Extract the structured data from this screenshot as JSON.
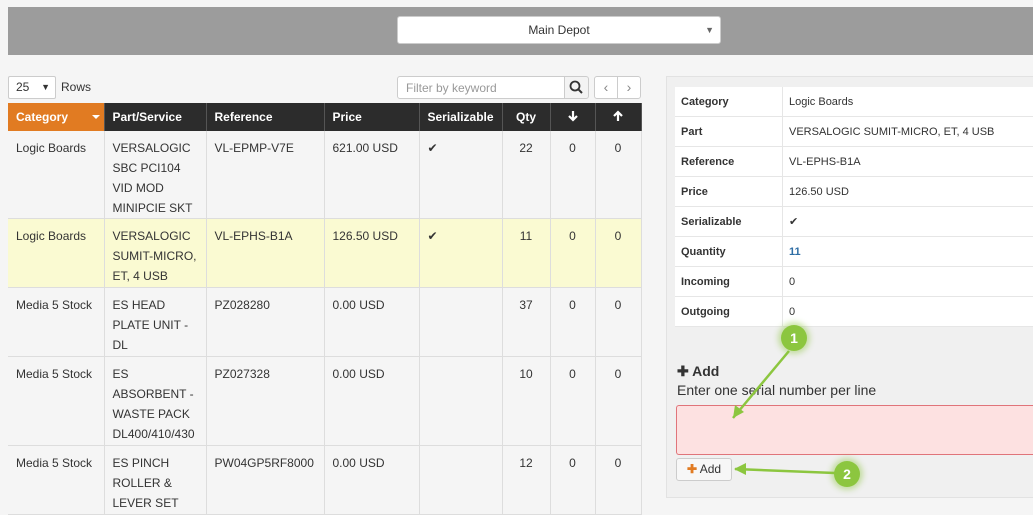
{
  "header": {
    "depot": "Main Depot"
  },
  "toolbar": {
    "rows_value": "25",
    "rows_label": "Rows",
    "filter_placeholder": "Filter by keyword"
  },
  "table": {
    "headers": [
      "Category",
      "Part/Service",
      "Reference",
      "Price",
      "Serializable",
      "Qty"
    ],
    "rows": [
      {
        "category": "Logic Boards",
        "part": "VERSALOGIC SBC PCI104 VID MOD MINIPCIE SKT",
        "reference": "VL-EPMP-V7E",
        "price": "621.00 USD",
        "serializable": "✔",
        "qty": "22",
        "incoming": "0",
        "outgoing": "0"
      },
      {
        "category": "Logic Boards",
        "part": "VERSALOGIC SUMIT-MICRO, ET, 4 USB",
        "reference": "VL-EPHS-B1A",
        "price": "126.50 USD",
        "serializable": "✔",
        "qty": "11",
        "incoming": "0",
        "outgoing": "0"
      },
      {
        "category": "Media 5 Stock",
        "part": "ES HEAD PLATE UNIT - DL",
        "reference": "PZ028280",
        "price": "0.00 USD",
        "serializable": "",
        "qty": "37",
        "incoming": "0",
        "outgoing": "0"
      },
      {
        "category": "Media 5 Stock",
        "part": "ES ABSORBENT - WASTE PACK DL400/410/430",
        "reference": "PZ027328",
        "price": "0.00 USD",
        "serializable": "",
        "qty": "10",
        "incoming": "0",
        "outgoing": "0"
      },
      {
        "category": "Media 5 Stock",
        "part": "ES PINCH ROLLER & LEVER SET",
        "reference": "PW04GP5RF8000",
        "price": "0.00 USD",
        "serializable": "",
        "qty": "12",
        "incoming": "0",
        "outgoing": "0"
      }
    ]
  },
  "details": {
    "rows": [
      {
        "label": "Category",
        "value": "Logic Boards"
      },
      {
        "label": "Part",
        "value": "VERSALOGIC SUMIT-MICRO, ET, 4 USB"
      },
      {
        "label": "Reference",
        "value": "VL-EPHS-B1A"
      },
      {
        "label": "Price",
        "value": "126.50 USD"
      },
      {
        "label": "Serializable",
        "value": "✔"
      },
      {
        "label": "Quantity",
        "value": "11"
      },
      {
        "label": "Incoming",
        "value": "0"
      },
      {
        "label": "Outgoing",
        "value": "0"
      }
    ],
    "add_title": "Add",
    "add_help": "Enter one serial number per line",
    "add_button": "Add"
  },
  "callouts": [
    "1",
    "2"
  ],
  "colors": {
    "accent": "#e17b22",
    "highlight_row": "#fafad2",
    "error_bg": "#fde1e1",
    "callout": "#8cc63f"
  }
}
